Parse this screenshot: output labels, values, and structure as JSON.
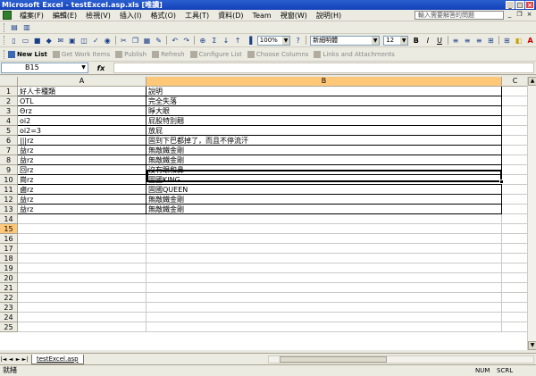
{
  "window": {
    "title": "Microsoft Excel - testExcel.asp.xls  [唯讀]"
  },
  "menubar": {
    "items": [
      "檔案(F)",
      "編輯(E)",
      "檢視(V)",
      "插入(I)",
      "格式(O)",
      "工具(T)",
      "資料(D)",
      "Team",
      "視窗(W)",
      "說明(H)"
    ],
    "help_placeholder": "輸入需要解答的問題"
  },
  "toolbar": {
    "zoom": "100%",
    "font": "新細明體",
    "font_size": "12",
    "bold": "B",
    "italic": "I",
    "underline": "U"
  },
  "team_toolbar": {
    "items": [
      "New List",
      "Get Work Items",
      "Publish",
      "Refresh",
      "Configure List",
      "Choose Columns",
      "Links and Attachments"
    ]
  },
  "formula_bar": {
    "name_box": "B15",
    "fx": "fx",
    "value": ""
  },
  "columns": [
    "A",
    "B",
    "C"
  ],
  "rows": [
    [
      "好人卡種類",
      "說明"
    ],
    [
      "OTL",
      "完全失落"
    ],
    [
      "Θrz",
      "睜大眼"
    ],
    [
      "oi2",
      "屁股特別翹"
    ],
    [
      "oi2=3",
      "放屁"
    ],
    [
      "|||rz",
      "固到下巴都掉了，而且不停流汗"
    ],
    [
      "益rz",
      "無敵鐵金剛"
    ],
    [
      "益rz",
      "無敵鐵金剛"
    ],
    [
      "回rz",
      "沒有眼和鼻"
    ],
    [
      "崗rz",
      "固國KING"
    ],
    [
      "鹵rz",
      "固國QUEEN"
    ],
    [
      "益rz",
      "無敵鐵金剛"
    ],
    [
      "益rz",
      "無敵鐵金剛"
    ]
  ],
  "row_numbers": [
    "1",
    "2",
    "3",
    "4",
    "5",
    "6",
    "7",
    "8",
    "9",
    "10",
    "11",
    "12",
    "13",
    "14",
    "15",
    "16",
    "17",
    "18",
    "19",
    "20",
    "21",
    "22",
    "23",
    "24",
    "25"
  ],
  "sheet_tab": "testExcel.asp",
  "status": {
    "left": "就緒",
    "num": "NUM",
    "scrl": "SCRL"
  }
}
